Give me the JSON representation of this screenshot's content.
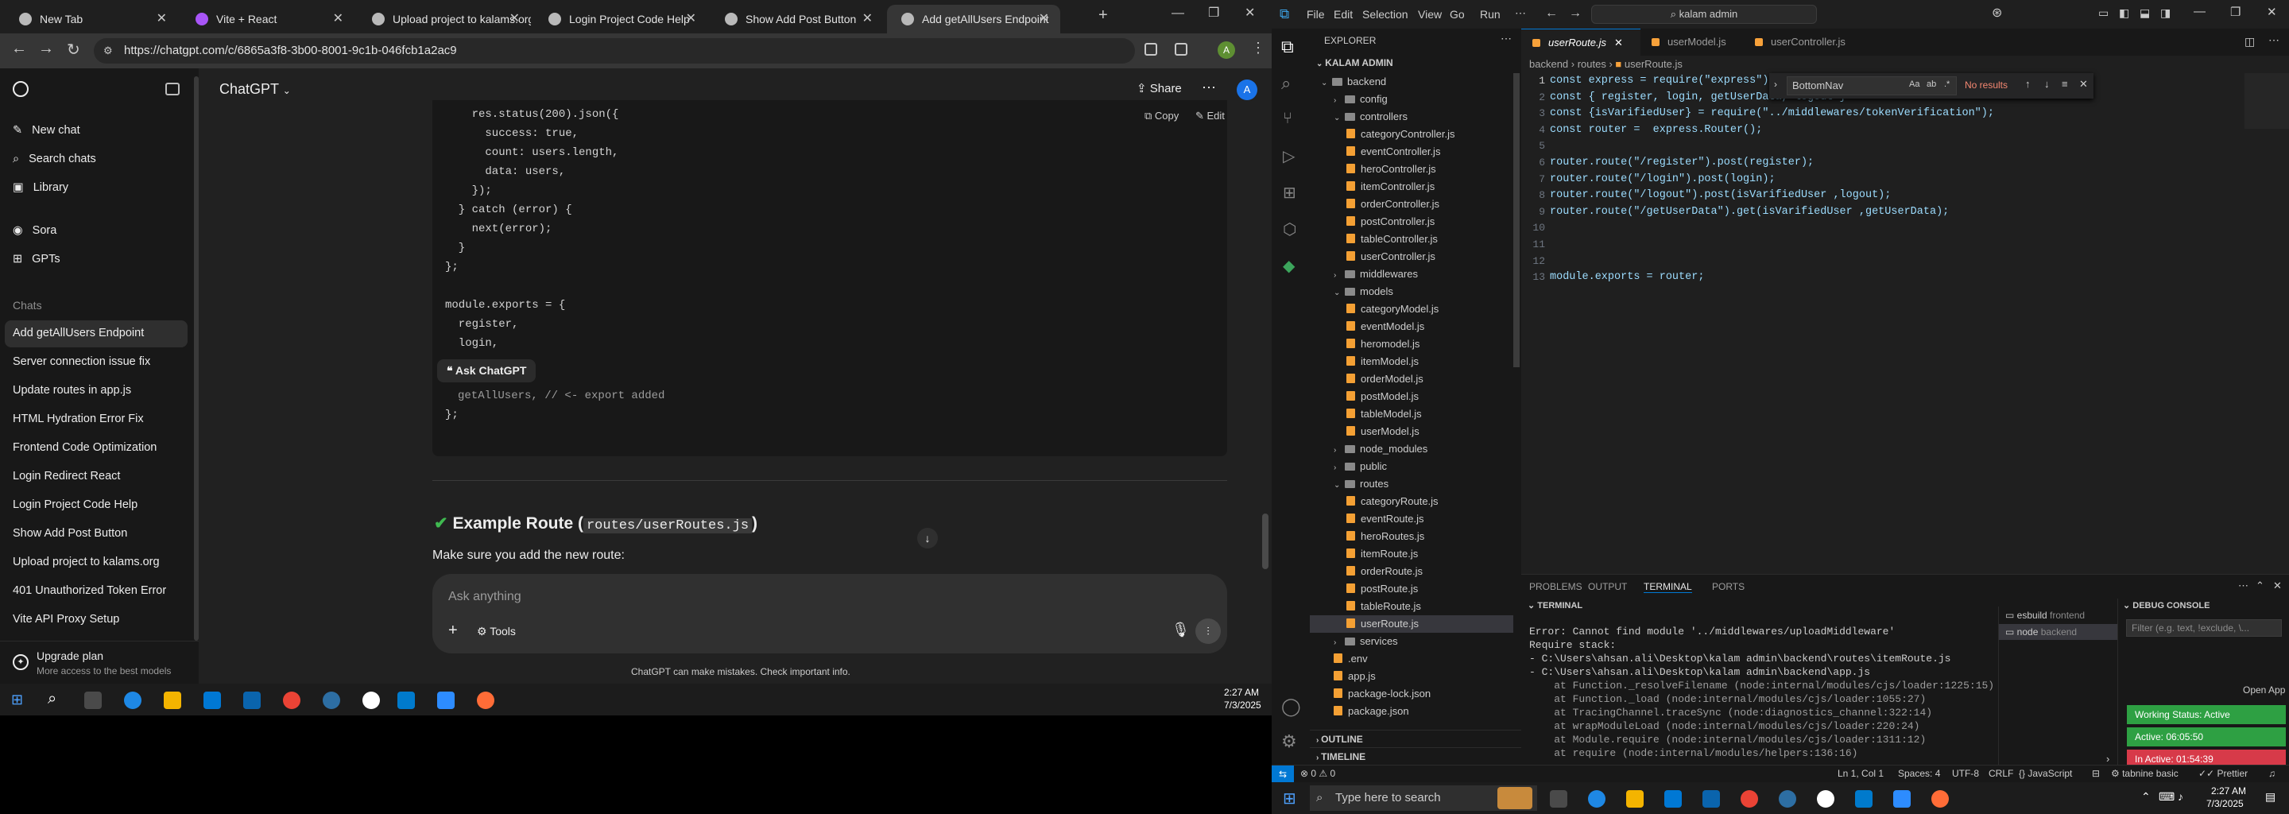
{
  "browser": {
    "tabs": [
      {
        "label": "New Tab"
      },
      {
        "label": "Vite + React"
      },
      {
        "label": "Upload project to kalams.org"
      },
      {
        "label": "Login Project Code Help"
      },
      {
        "label": "Show Add Post Button"
      },
      {
        "label": "Add getAllUsers Endpoint"
      }
    ],
    "url": "https://chatgpt.com/c/6865a3f8-3b00-8001-9c1b-046fcb1a2ac9",
    "avatar_letter": "A"
  },
  "chatgpt": {
    "title": "ChatGPT",
    "share_label": "Share",
    "user_avatar": "A",
    "nav": [
      {
        "label": "New chat"
      },
      {
        "label": "Search chats"
      },
      {
        "label": "Library"
      },
      {
        "label": "Sora"
      },
      {
        "label": "GPTs"
      }
    ],
    "chats_heading": "Chats",
    "chats": [
      "Add getAllUsers Endpoint",
      "Server connection issue fix",
      "Update routes in app.js",
      "HTML Hydration Error Fix",
      "Frontend Code Optimization",
      "Login Redirect React",
      "Login Project Code Help",
      "Show Add Post Button",
      "Upload project to kalams.org",
      "401 Unauthorized Token Error",
      "Vite API Proxy Setup"
    ],
    "upgrade": {
      "title": "Upgrade plan",
      "subtitle": "More access to the best models"
    },
    "code_copy": "Copy",
    "code_edit": "Edit",
    "code_lines": [
      "    res.status(200).json({",
      "      success: true,",
      "      count: users.length,",
      "      data: users,",
      "    });",
      "  } catch (error) {",
      "    next(error);",
      "  }",
      "};",
      "",
      "module.exports = {",
      "  register,",
      "  login,"
    ],
    "ask_chatgpt": "Ask ChatGPT",
    "code_tail_1": "getAllUsers, // <- export added",
    "code_tail_2": "};",
    "example_heading": "Example Route (",
    "example_code": "routes/userRoutes.js",
    "example_close": ")",
    "make_sure": "Make sure you add the new route:",
    "input_placeholder": "Ask anything",
    "tools_label": "Tools",
    "disclaimer": "ChatGPT can make mistakes. Check important info.",
    "time": "2:27 AM",
    "date": "7/3/2025"
  },
  "vscode": {
    "menu": [
      "File",
      "Edit",
      "Selection",
      "View",
      "Go",
      "Run"
    ],
    "search": "kalam admin",
    "explorer_title": "EXPLORER",
    "workspace": "KALAM ADMIN",
    "tree": [
      {
        "label": "backend",
        "type": "folder-open",
        "depth": 0
      },
      {
        "label": "config",
        "type": "folder",
        "depth": 1
      },
      {
        "label": "controllers",
        "type": "folder-open",
        "depth": 1
      },
      {
        "label": "categoryController.js",
        "type": "file",
        "depth": 2
      },
      {
        "label": "eventController.js",
        "type": "file",
        "depth": 2
      },
      {
        "label": "heroController.js",
        "type": "file",
        "depth": 2
      },
      {
        "label": "itemController.js",
        "type": "file",
        "depth": 2
      },
      {
        "label": "orderController.js",
        "type": "file",
        "depth": 2
      },
      {
        "label": "postController.js",
        "type": "file",
        "depth": 2
      },
      {
        "label": "tableController.js",
        "type": "file",
        "depth": 2
      },
      {
        "label": "userController.js",
        "type": "file",
        "depth": 2
      },
      {
        "label": "middlewares",
        "type": "folder",
        "depth": 1
      },
      {
        "label": "models",
        "type": "folder-open",
        "depth": 1
      },
      {
        "label": "categoryModel.js",
        "type": "file",
        "depth": 2
      },
      {
        "label": "eventModel.js",
        "type": "file",
        "depth": 2
      },
      {
        "label": "heromodel.js",
        "type": "file",
        "depth": 2
      },
      {
        "label": "itemModel.js",
        "type": "file",
        "depth": 2
      },
      {
        "label": "orderModel.js",
        "type": "file",
        "depth": 2
      },
      {
        "label": "postModel.js",
        "type": "file",
        "depth": 2
      },
      {
        "label": "tableModel.js",
        "type": "file",
        "depth": 2
      },
      {
        "label": "userModel.js",
        "type": "file",
        "depth": 2
      },
      {
        "label": "node_modules",
        "type": "folder",
        "depth": 1
      },
      {
        "label": "public",
        "type": "folder",
        "depth": 1
      },
      {
        "label": "routes",
        "type": "folder-open",
        "depth": 1
      },
      {
        "label": "categoryRoute.js",
        "type": "file",
        "depth": 2
      },
      {
        "label": "eventRoute.js",
        "type": "file",
        "depth": 2
      },
      {
        "label": "heroRoutes.js",
        "type": "file",
        "depth": 2
      },
      {
        "label": "itemRoute.js",
        "type": "file",
        "depth": 2
      },
      {
        "label": "orderRoute.js",
        "type": "file",
        "depth": 2
      },
      {
        "label": "postRoute.js",
        "type": "file",
        "depth": 2
      },
      {
        "label": "tableRoute.js",
        "type": "file",
        "depth": 2
      },
      {
        "label": "userRoute.js",
        "type": "file",
        "depth": 2,
        "selected": true
      },
      {
        "label": "services",
        "type": "folder",
        "depth": 1
      },
      {
        "label": ".env",
        "type": "file",
        "depth": 1
      },
      {
        "label": "app.js",
        "type": "file",
        "depth": 1
      },
      {
        "label": "package-lock.json",
        "type": "file",
        "depth": 1
      },
      {
        "label": "package.json",
        "type": "file",
        "depth": 1
      }
    ],
    "outline": "OUTLINE",
    "timeline": "TIMELINE",
    "editor_tabs": [
      "userRoute.js",
      "userModel.js",
      "userController.js"
    ],
    "breadcrumb": [
      "backend",
      "routes",
      "userRoute.js"
    ],
    "find": {
      "value": "BottomNav",
      "result": "No results"
    },
    "code": [
      "const express = require(\"express\");",
      "const { register, login, getUserData, logout }",
      "const {isVarifiedUser} = require(\"../middlewares/tokenVerification\");",
      "const router =  express.Router();",
      "",
      "router.route(\"/register\").post(register);",
      "router.route(\"/login\").post(login);",
      "router.route(\"/logout\").post(isVarifiedUser ,logout);",
      "router.route(\"/getUserData\").get(isVarifiedUser ,getUserData);",
      "",
      "",
      "",
      "module.exports = router;"
    ],
    "panel_tabs": [
      "PROBLEMS",
      "OUTPUT",
      "TERMINAL",
      "PORTS"
    ],
    "terminal_title": "TERMINAL",
    "terminal_lines": [
      "Error: Cannot find module '../middlewares/uploadMiddleware'",
      "Require stack:",
      "- C:\\Users\\ahsan.ali\\Desktop\\kalam admin\\backend\\routes\\itemRoute.js",
      "- C:\\Users\\ahsan.ali\\Desktop\\kalam admin\\backend\\app.js",
      "    at Function._resolveFilename (node:internal/modules/cjs/loader:1225:15)",
      "    at Function._load (node:internal/modules/cjs/loader:1055:27)",
      "    at TracingChannel.traceSync (node:diagnostics_channel:322:14)",
      "    at wrapModuleLoad (node:internal/modules/cjs/loader:220:24)",
      "    at Module.require (node:internal/modules/cjs/loader:1311:12)",
      "    at require (node:internal/modules/helpers:136:16)"
    ],
    "terminals": [
      {
        "name": "esbuild",
        "dir": "frontend"
      },
      {
        "name": "node",
        "dir": "backend"
      }
    ],
    "debug_console": "DEBUG CONSOLE",
    "debug_filter_placeholder": "Filter (e.g. text, !exclude, \\...",
    "open_app": "Open App",
    "working_status": "Working Status: Active",
    "active": "Active: 06:05:50",
    "inactive": "In Active: 01:54:39",
    "status": {
      "errors": "0",
      "warnings": "0",
      "position": "Ln 1, Col 1",
      "spaces": "Spaces: 4",
      "encoding": "UTF-8",
      "eol": "CRLF",
      "language": "JavaScript",
      "tabnine": "tabnine basic",
      "prettier": "Prettier"
    },
    "taskbar_search": "Type here to search",
    "time": "2:27 AM",
    "date": "7/3/2025"
  }
}
